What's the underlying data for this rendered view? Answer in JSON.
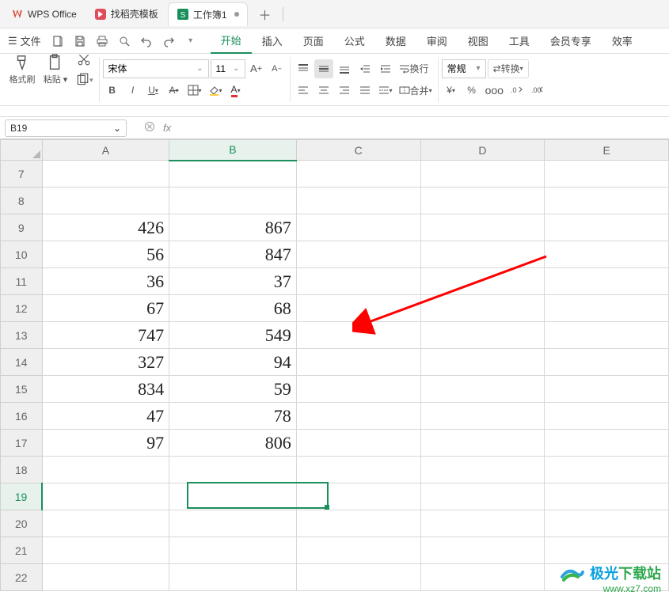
{
  "tabs": {
    "app": "WPS Office",
    "template": "找稻壳模板",
    "workbook": "工作簿1"
  },
  "menu": {
    "file": "文件",
    "items": [
      "开始",
      "插入",
      "页面",
      "公式",
      "数据",
      "审阅",
      "视图",
      "工具",
      "会员专享",
      "效率"
    ],
    "activeIndex": 0
  },
  "ribbon": {
    "format_painter": "格式刷",
    "paste": "粘贴",
    "font_name": "宋体",
    "font_size": "11",
    "wrap": "换行",
    "merge": "合并",
    "number_format": "常规",
    "convert": "转换"
  },
  "cellref": {
    "name": "B19",
    "fx": "fx"
  },
  "columns": [
    "A",
    "B",
    "C",
    "D",
    "E"
  ],
  "rows": [
    "7",
    "8",
    "9",
    "10",
    "11",
    "12",
    "13",
    "14",
    "15",
    "16",
    "17",
    "18",
    "19",
    "20",
    "21",
    "22"
  ],
  "cells": {
    "A9": "426",
    "B9": "867",
    "A10": "56",
    "B10": "847",
    "A11": "36",
    "B11": "37",
    "A12": "67",
    "B12": "68",
    "A13": "747",
    "B13": "549",
    "A14": "327",
    "B14": "94",
    "A15": "834",
    "B15": "59",
    "A16": "47",
    "B16": "78",
    "A17": "97",
    "B17": "806"
  },
  "active": {
    "col": "B",
    "row": "19"
  },
  "watermark": {
    "brand_a": "极光",
    "brand_b": "下载站",
    "url": "www.xz7.com"
  }
}
